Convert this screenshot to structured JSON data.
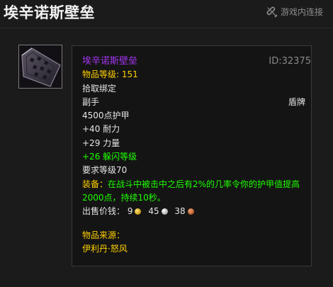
{
  "header": {
    "title": "埃辛诺斯壁垒",
    "ingame_link_label": "游戏内连接",
    "link_icon": "link-broken-icon"
  },
  "item": {
    "icon": "shield-item-icon",
    "name": "埃辛诺斯壁垒",
    "name_color": "#a335ee",
    "id_label": "ID:32375",
    "item_level_label": "物品等级:",
    "item_level": "151",
    "bind": "拾取绑定",
    "slot": "副手",
    "type": "盾牌",
    "armor": "4500点护甲",
    "stats": [
      {
        "text": "+40 耐力",
        "color": "#e6e6e6"
      },
      {
        "text": "+29 力量",
        "color": "#e6e6e6"
      },
      {
        "text": "+26 躲闪等级",
        "color": "#1eff00"
      }
    ],
    "required_level": "要求等级70",
    "equip_label": "装备：",
    "equip_text": "在战斗中被击中之后有2%的几率令你的护甲值提高2000点，持续10秒。",
    "sell_price_label": "出售价钱：",
    "sell_price": {
      "gold": "9",
      "silver": "45",
      "copper": "38"
    },
    "source_label": "物品来源：",
    "source_value": "伊利丹·怒风"
  }
}
